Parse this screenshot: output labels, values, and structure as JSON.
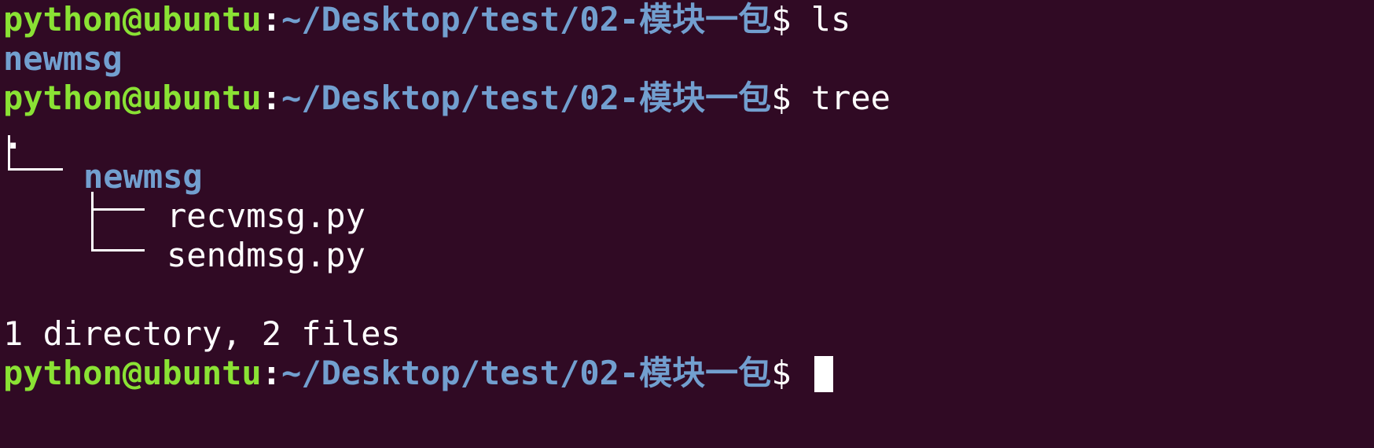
{
  "prompt": {
    "user_host": "python@ubuntu",
    "colon": ":",
    "path": "~/Desktop/test/02-模块一包",
    "dollar": "$"
  },
  "lines": {
    "cmd1": " ls",
    "out1": "newmsg",
    "cmd2": " tree",
    "tree_root": ".",
    "tree_dir": "newmsg",
    "tree_file1": "recvmsg.py",
    "tree_file2": "sendmsg.py",
    "summary": "1 directory, 2 files"
  },
  "colors": {
    "background": "#300a24",
    "user_host": "#8ae234",
    "path": "#729fcf",
    "text": "#ffffff"
  }
}
